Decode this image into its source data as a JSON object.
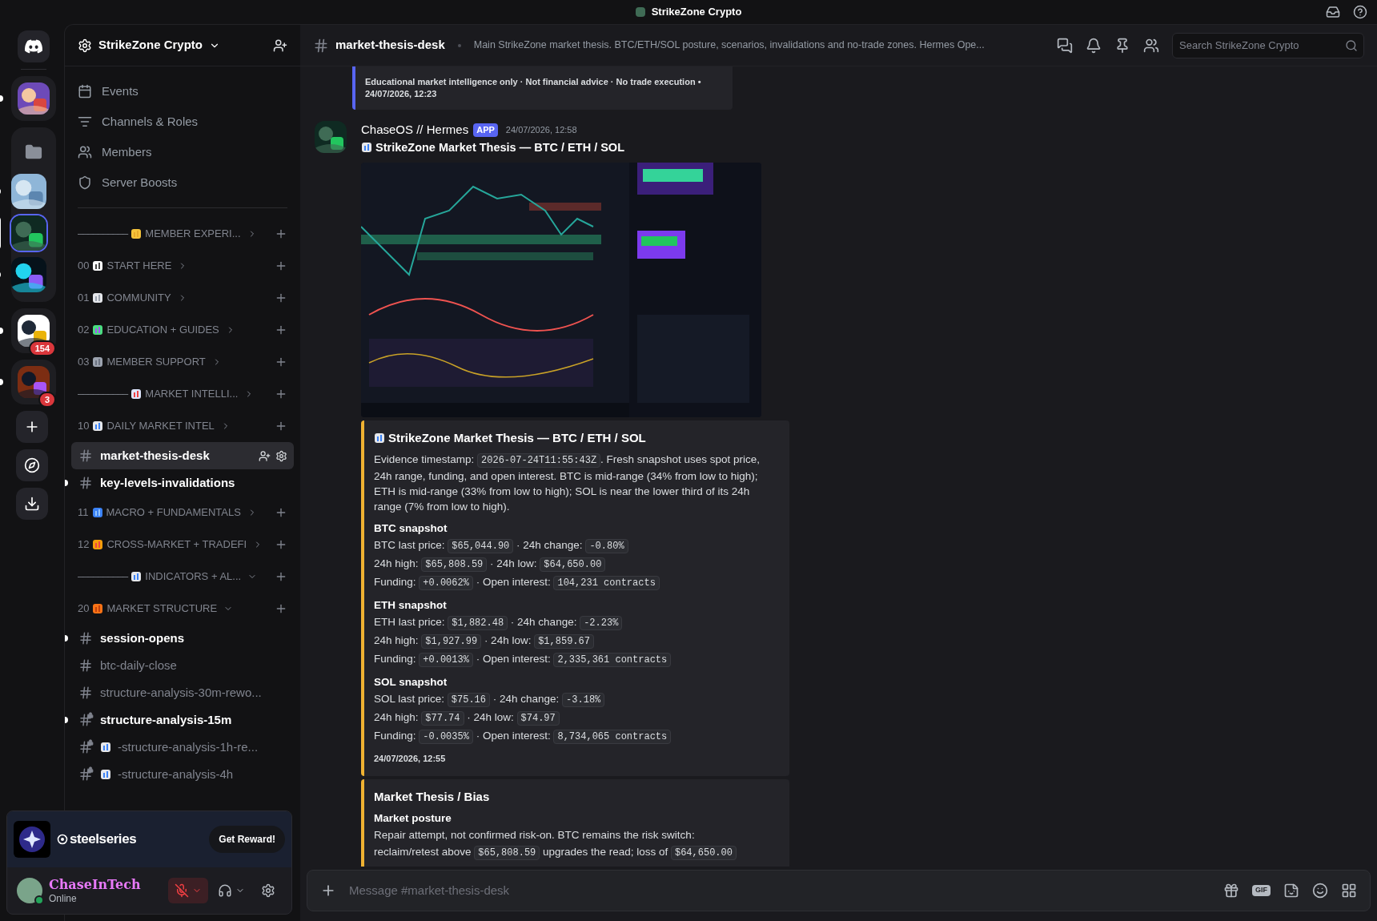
{
  "window": {
    "title": "StrikeZone Crypto"
  },
  "servers": [
    {
      "kind": "home"
    },
    {
      "kind": "group",
      "unread": true,
      "selected": false
    },
    {
      "kind": "folder",
      "children": [
        {
          "kind": "server",
          "unread": true,
          "selected": false
        },
        {
          "kind": "server",
          "unread": false,
          "selected": true
        },
        {
          "kind": "server",
          "unread": true,
          "selected": false
        }
      ]
    },
    {
      "kind": "group",
      "unread": true,
      "selected": false,
      "badge": "154"
    },
    {
      "kind": "group",
      "unread": true,
      "selected": false,
      "badge": "3"
    },
    {
      "kind": "action"
    },
    {
      "kind": "action"
    },
    {
      "kind": "action"
    }
  ],
  "server_header": {
    "name": "StrikeZone Crypto"
  },
  "channel_list": [
    {
      "kind": "nav",
      "label": "Events"
    },
    {
      "kind": "nav",
      "label": "Channels & Roles"
    },
    {
      "kind": "nav",
      "label": "Members"
    },
    {
      "kind": "nav",
      "label": "Server Boosts"
    },
    {
      "kind": "divider"
    },
    {
      "kind": "separator",
      "dashes": "––––––––––",
      "label": "MEMBER EXPERI...",
      "expanded": false
    },
    {
      "kind": "category",
      "number": "00",
      "label": "START HERE",
      "expanded": false
    },
    {
      "kind": "category",
      "number": "01",
      "label": "COMMUNITY",
      "expanded": false
    },
    {
      "kind": "category",
      "number": "02",
      "label": "EDUCATION + GUIDES",
      "expanded": false
    },
    {
      "kind": "category",
      "number": "03",
      "label": "MEMBER SUPPORT",
      "expanded": false
    },
    {
      "kind": "separator",
      "dashes": "––––––––––",
      "label": "MARKET INTELLI...",
      "expanded": false
    },
    {
      "kind": "category",
      "number": "10",
      "label": "DAILY MARKET INTEL",
      "expanded": false
    },
    {
      "kind": "channel",
      "name": "market-thesis-desk",
      "selected": true,
      "unread": false,
      "locked": false
    },
    {
      "kind": "channel",
      "name": "key-levels-invalidations",
      "selected": false,
      "unread": true,
      "locked": false
    },
    {
      "kind": "category",
      "number": "11",
      "label": "MACRO + FUNDAMENTALS",
      "expanded": false
    },
    {
      "kind": "category",
      "number": "12",
      "label": "CROSS-MARKET + TRADEFI",
      "expanded": false
    },
    {
      "kind": "separator",
      "dashes": "––––––––––",
      "label": "INDICATORS + AL...",
      "expanded": true
    },
    {
      "kind": "category",
      "number": "20",
      "label": "MARKET STRUCTURE",
      "expanded": true
    },
    {
      "kind": "channel",
      "name": "session-opens",
      "selected": false,
      "unread": true,
      "locked": false
    },
    {
      "kind": "channel",
      "name": "btc-daily-close",
      "selected": false,
      "unread": false,
      "locked": false
    },
    {
      "kind": "channel",
      "name": "structure-analysis-30m-rewo...",
      "selected": false,
      "unread": false,
      "locked": false
    },
    {
      "kind": "channel",
      "name": "structure-analysis-15m",
      "selected": false,
      "unread": true,
      "locked": true
    },
    {
      "kind": "channel",
      "name": "-structure-analysis-1h-re...",
      "selected": false,
      "unread": false,
      "locked": true
    },
    {
      "kind": "channel",
      "name": "-structure-analysis-4h",
      "selected": false,
      "unread": false,
      "locked": true
    }
  ],
  "promo": {
    "brand": "steelseries",
    "button": "Get Reward!"
  },
  "user": {
    "name": "ChaseInTech",
    "status": "Online",
    "muted": true
  },
  "channel_header": {
    "name": "market-thesis-desk",
    "topic": "Main StrikeZone market thesis. BTC/ETH/SOL posture, scenarios, invalidations and no-trade zones. Hermes Ope...",
    "search_placeholder": "Search StrikeZone Crypto"
  },
  "previous_embed": {
    "color": "#5865f2",
    "footer": "Educational market intelligence only · Not financial advice · No trade execution • 24/07/2026, 12:23"
  },
  "message": {
    "author": "ChaseOS // Hermes",
    "tag": "APP",
    "time": "24/07/2026, 12:58",
    "title": "StrikeZone Market Thesis — BTC / ETH / SOL",
    "embeds": [
      {
        "color": "#f0b232",
        "title": "StrikeZone Market Thesis — BTC / ETH / SOL",
        "intro": [
          {
            "kind": "text",
            "text": "Evidence timestamp: "
          },
          {
            "kind": "code",
            "text": "2026-07-24T11:55:43Z"
          },
          {
            "kind": "text",
            "text": ". Fresh snapshot uses spot price, 24h range, funding, and open interest. BTC is mid-range (34% from low to high); ETH is mid-range (33% from low to high); SOL is near the lower third of its 24h range (7% from low to high)."
          }
        ],
        "sections": [
          {
            "heading": "BTC snapshot",
            "lines": [
              [
                {
                  "kind": "text",
                  "text": "BTC last price: "
                },
                {
                  "kind": "code",
                  "text": "$65,044.90"
                },
                {
                  "kind": "text",
                  "text": " · 24h change: "
                },
                {
                  "kind": "code",
                  "text": "-0.80%"
                }
              ],
              [
                {
                  "kind": "text",
                  "text": "24h high: "
                },
                {
                  "kind": "code",
                  "text": "$65,808.59"
                },
                {
                  "kind": "text",
                  "text": " · 24h low: "
                },
                {
                  "kind": "code",
                  "text": "$64,650.00"
                }
              ],
              [
                {
                  "kind": "text",
                  "text": "Funding: "
                },
                {
                  "kind": "code",
                  "text": "+0.0062%"
                },
                {
                  "kind": "text",
                  "text": " · Open interest: "
                },
                {
                  "kind": "code",
                  "text": "104,231 contracts"
                }
              ]
            ]
          },
          {
            "heading": "ETH snapshot",
            "lines": [
              [
                {
                  "kind": "text",
                  "text": "ETH last price: "
                },
                {
                  "kind": "code",
                  "text": "$1,882.48"
                },
                {
                  "kind": "text",
                  "text": " · 24h change: "
                },
                {
                  "kind": "code",
                  "text": "-2.23%"
                }
              ],
              [
                {
                  "kind": "text",
                  "text": "24h high: "
                },
                {
                  "kind": "code",
                  "text": "$1,927.99"
                },
                {
                  "kind": "text",
                  "text": " · 24h low: "
                },
                {
                  "kind": "code",
                  "text": "$1,859.67"
                }
              ],
              [
                {
                  "kind": "text",
                  "text": "Funding: "
                },
                {
                  "kind": "code",
                  "text": "+0.0013%"
                },
                {
                  "kind": "text",
                  "text": " · Open interest: "
                },
                {
                  "kind": "code",
                  "text": "2,335,361 contracts"
                }
              ]
            ]
          },
          {
            "heading": "SOL snapshot",
            "lines": [
              [
                {
                  "kind": "text",
                  "text": "SOL last price: "
                },
                {
                  "kind": "code",
                  "text": "$75.16"
                },
                {
                  "kind": "text",
                  "text": " · 24h change: "
                },
                {
                  "kind": "code",
                  "text": "-3.18%"
                }
              ],
              [
                {
                  "kind": "text",
                  "text": "24h high: "
                },
                {
                  "kind": "code",
                  "text": "$77.74"
                },
                {
                  "kind": "text",
                  "text": " · 24h low: "
                },
                {
                  "kind": "code",
                  "text": "$74.97"
                }
              ],
              [
                {
                  "kind": "text",
                  "text": "Funding: "
                },
                {
                  "kind": "code",
                  "text": "-0.0035%"
                },
                {
                  "kind": "text",
                  "text": " · Open interest: "
                },
                {
                  "kind": "code",
                  "text": "8,734,065 contracts"
                }
              ]
            ]
          }
        ],
        "footer": "24/07/2026, 12:55"
      },
      {
        "color": "#f0b232",
        "title": "Market Thesis / Bias",
        "sections": [
          {
            "heading": "Market posture",
            "lines": [
              [
                {
                  "kind": "text",
                  "text": "Repair attempt, not confirmed risk-on. BTC remains the risk switch:"
                }
              ],
              [
                {
                  "kind": "text",
                  "text": "reclaim/retest above "
                },
                {
                  "kind": "code",
                  "text": "$65,808.59"
                },
                {
                  "kind": "text",
                  "text": " upgrades the read; loss of "
                },
                {
                  "kind": "code",
                  "text": "$64,650.00"
                }
              ]
            ]
          }
        ]
      }
    ]
  },
  "composer": {
    "placeholder": "Message #market-thesis-desk",
    "gif": "GIF"
  }
}
